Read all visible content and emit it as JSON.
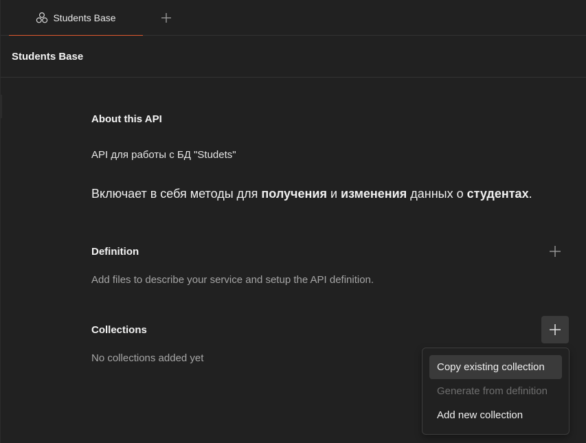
{
  "tabs": [
    {
      "label": "Students Base",
      "icon": "api-hexagons-icon",
      "active": true
    }
  ],
  "tab_add_icon": "plus-icon",
  "page_title": "Students Base",
  "about": {
    "heading": "About this API",
    "summary": "API для работы с БД \"Studets\"",
    "description_parts": {
      "p1": "Включает в себя методы для ",
      "b1": "получения",
      "p2": " и ",
      "b2": "изменения",
      "p3": " данных о ",
      "b3": "студентах",
      "p4": "."
    }
  },
  "definition": {
    "heading": "Definition",
    "hint": "Add files to describe your service and setup the API definition."
  },
  "collections": {
    "heading": "Collections",
    "empty_text": "No collections added yet"
  },
  "menu": {
    "items": [
      {
        "label": "Copy existing collection",
        "state": "hover"
      },
      {
        "label": "Generate from definition",
        "state": "disabled"
      },
      {
        "label": "Add new collection",
        "state": "normal"
      }
    ]
  },
  "colors": {
    "background": "#212121",
    "accent": "#e2592f",
    "muted_text": "#a6a6a6",
    "disabled_text": "#6e6e6e"
  }
}
